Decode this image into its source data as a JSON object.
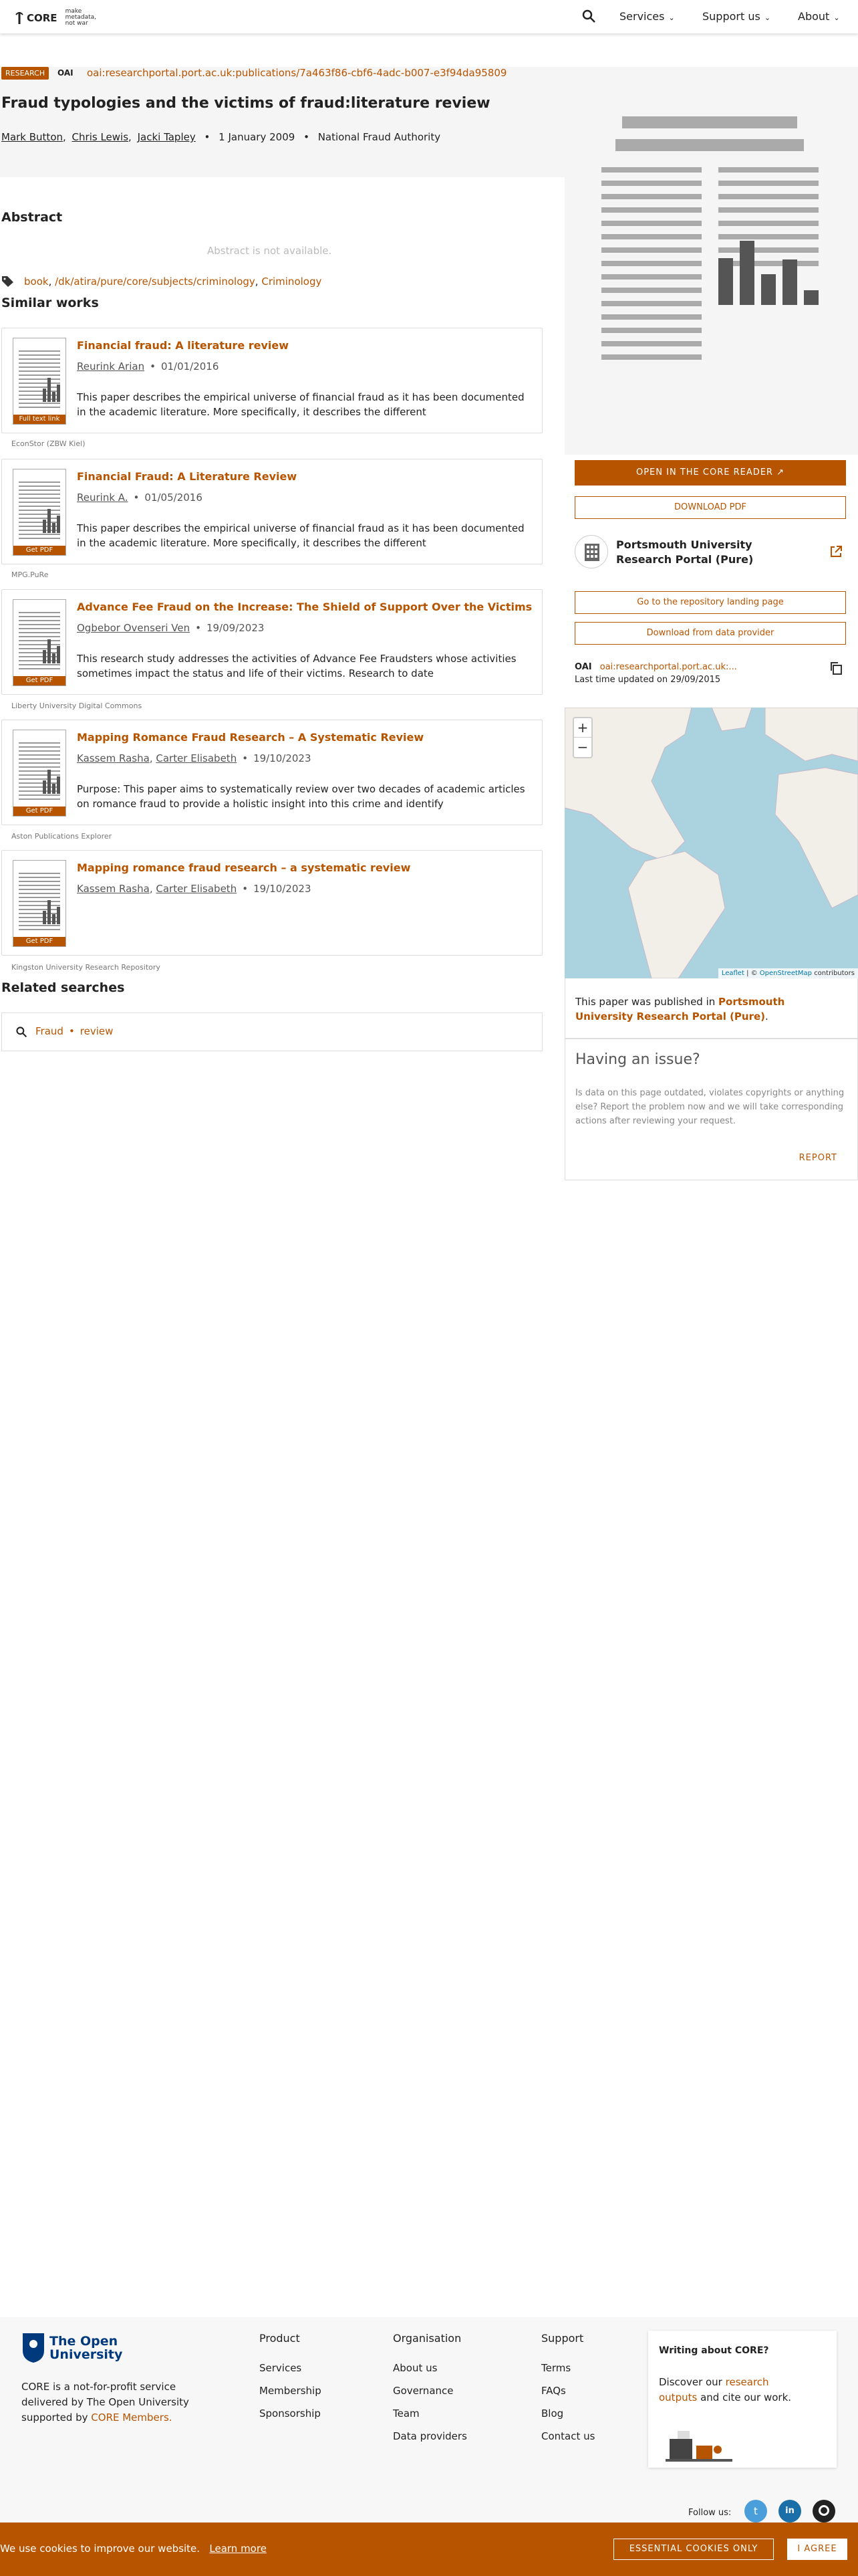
{
  "header": {
    "logo_text": "CORE",
    "tagline": "make metadata, not war",
    "nav": [
      {
        "label": "Services"
      },
      {
        "label": "Support us"
      },
      {
        "label": "About"
      }
    ]
  },
  "paper": {
    "badge": "RESEARCH",
    "oai_logo": "OAI",
    "oai_id": "oai:researchportal.port.ac.uk:publications/7a463f86-cbf6-4adc-b007-e3f94da95809",
    "title": "Fraud typologies and the victims of fraud:literature review",
    "authors": [
      "Mark Button",
      "Chris Lewis",
      "Jacki Tapley"
    ],
    "date": "1 January 2009",
    "publisher": "National Fraud Authority"
  },
  "abstract": {
    "heading": "Abstract",
    "text": "Abstract is not available."
  },
  "tags": [
    "book",
    "/dk/atira/pure/core/subjects/criminology",
    "Criminology"
  ],
  "similar": {
    "heading": "Similar works",
    "items": [
      {
        "title": "Financial fraud: A literature review",
        "authors": [
          "Reurink Arian"
        ],
        "date": "01/01/2016",
        "desc": "This paper describes the empirical universe of financial fraud as it has been documented in the academic literature. More specifically, it describes the different",
        "thumb_label": "Full text link",
        "source": "EconStor (ZBW Kiel)"
      },
      {
        "title": "Financial Fraud: A Literature Review",
        "authors": [
          "Reurink A."
        ],
        "date": "01/05/2016",
        "desc": "This paper describes the empirical universe of financial fraud as it has been documented in the academic literature. More specifically, it describes the different",
        "thumb_label": "Get PDF",
        "source": "MPG.PuRe"
      },
      {
        "title": "Advance Fee Fraud on the Increase: The Shield of Support Over the Victims",
        "authors": [
          "Ogbebor Ovenseri Ven"
        ],
        "date": "19/09/2023",
        "desc": "This research study addresses the activities of Advance Fee Fraudsters whose activities sometimes impact the status and life of their victims. Research to date",
        "thumb_label": "Get PDF",
        "source": "Liberty University Digital Commons"
      },
      {
        "title": "Mapping Romance Fraud Research – A Systematic Review",
        "authors": [
          "Kassem Rasha",
          "Carter Elisabeth"
        ],
        "date": "19/10/2023",
        "desc": "Purpose: This paper aims to systematically review over two decades of academic articles on romance fraud to provide a holistic insight into this crime and identify",
        "thumb_label": "Get PDF",
        "source": "Aston Publications Explorer"
      },
      {
        "title": "Mapping romance fraud research – a systematic review",
        "authors": [
          "Kassem Rasha",
          "Carter Elisabeth"
        ],
        "date": "19/10/2023",
        "desc": "",
        "thumb_label": "Get PDF",
        "source": "Kingston University Research Repository"
      }
    ]
  },
  "related": {
    "heading": "Related searches",
    "terms": [
      "Fraud",
      "review"
    ]
  },
  "sidebar": {
    "open_reader": "OPEN IN THE CORE READER",
    "download_pdf": "DOWNLOAD PDF",
    "repo_name": "Portsmouth University Research Portal (Pure)",
    "landing": "Go to the repository landing page",
    "download_provider": "Download from data provider",
    "oai_short": "oai:researchportal.port.ac.uk:...",
    "last_updated": "Last time updated on 29/09/2015",
    "map_attr_leaflet": "Leaflet",
    "map_attr_osm": "OpenStreetMap",
    "map_attr_contrib": "contributors",
    "published_prefix": "This paper was published in",
    "published_repo": "Portsmouth University Research Portal (Pure)",
    "issue_heading": "Having an issue?",
    "issue_text": "Is data on this page outdated, violates copyrights or anything else? Report the problem now and we will take corresponding actions after reviewing your request.",
    "report": "REPORT"
  },
  "footer": {
    "ou_line1": "The Open",
    "ou_line2": "University",
    "about_pre": "CORE is a not-for-profit service delivered by The Open University supported by",
    "about_link": "CORE Members.",
    "columns": [
      {
        "heading": "Product",
        "links": [
          "Services",
          "Membership",
          "Sponsorship"
        ]
      },
      {
        "heading": "Organisation",
        "links": [
          "About us",
          "Governance",
          "Team",
          "Data providers"
        ]
      },
      {
        "heading": "Support",
        "links": [
          "Terms",
          "FAQs",
          "Blog",
          "Contact us"
        ]
      }
    ],
    "ad_title": "Writing about CORE?",
    "ad_pre": "Discover our",
    "ad_link": "research outputs",
    "ad_post": "and cite our work.",
    "follow": "Follow us:"
  },
  "cookie": {
    "text": "We use cookies to improve our website.",
    "learn": "Learn more",
    "essential": "ESSENTIAL COOKIES ONLY",
    "agree": "I AGREE"
  },
  "colors": {
    "accent": "#b75400",
    "map_water": "#aad3df"
  }
}
